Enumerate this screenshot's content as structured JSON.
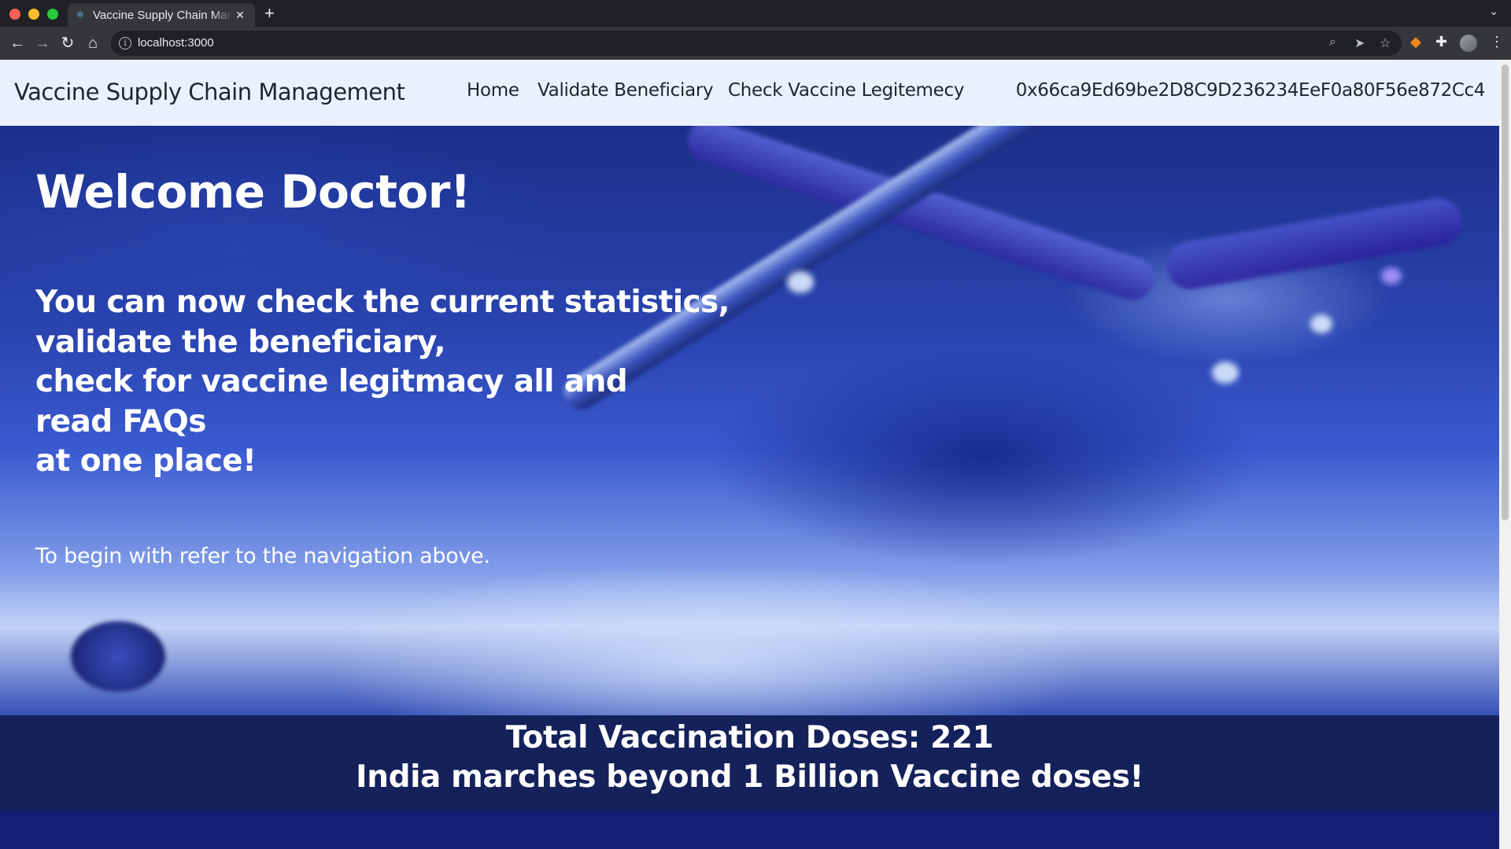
{
  "browser": {
    "tab_title": "Vaccine Supply Chain Management",
    "tab_close": "✕",
    "new_tab": "+",
    "url": "localhost:3000",
    "icons": [
      "react-icon",
      "back-icon",
      "forward-icon",
      "reload-icon",
      "home-icon",
      "info-icon",
      "zoom-icon",
      "send-icon",
      "bookmark-star-icon",
      "metamask-fox-icon",
      "extensions-puzzle-icon",
      "profile-avatar-icon",
      "more-menu-icon"
    ]
  },
  "navbar": {
    "brand": "Vaccine Supply Chain Management",
    "links": [
      "Home",
      "Validate Beneficiary",
      "Check Vaccine Legitemecy"
    ],
    "account": "0x66ca9Ed69be2D8C9D236234EeF0a80F56e872Cc4"
  },
  "hero": {
    "title": "Welcome Doctor!",
    "lead_lines": [
      "You can now check the current statistics,",
      "validate the beneficiary,",
      "check for vaccine legitmacy all and",
      "read FAQs",
      "at one place!"
    ],
    "instruction": "To begin with refer to the navigation above."
  },
  "stats": {
    "line1": "Total Vaccination Doses: 221",
    "line2": "India marches beyond 1 Billion Vaccine doses!"
  },
  "colors": {
    "navbar_bg": "#e9f2fc",
    "stats_bg": "#14215a",
    "hero_blue": "#2a44b0"
  }
}
